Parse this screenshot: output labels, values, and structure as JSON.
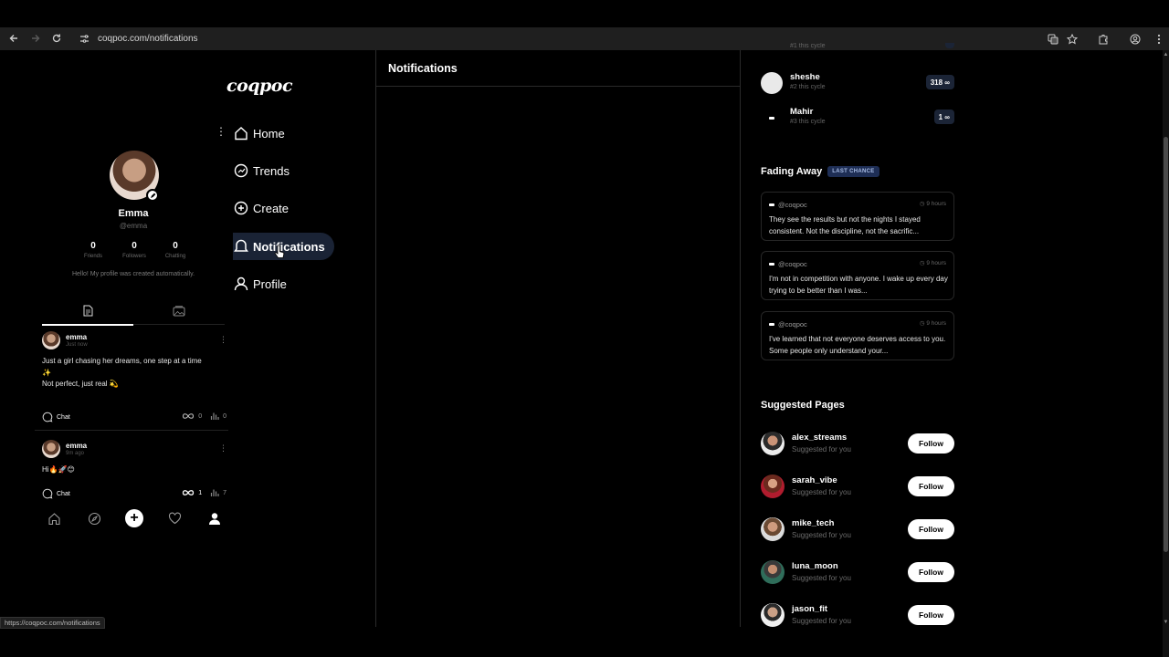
{
  "browser": {
    "url": "coqpoc.com/notifications",
    "status_url": "https://coqpoc.com/notifications"
  },
  "brand": "coqpoc",
  "profile": {
    "name": "Emma",
    "handle": "@emma",
    "stats": [
      {
        "value": "0",
        "label": "Friends"
      },
      {
        "value": "0",
        "label": "Followers"
      },
      {
        "value": "0",
        "label": "Chatting"
      }
    ],
    "bio": "Hello! My profile was created automatically."
  },
  "posts": [
    {
      "author": "emma",
      "time": "Just now",
      "lines": [
        "Just a girl chasing her dreams, one step at a time",
        "✨",
        "Not perfect, just real 💫"
      ],
      "chat_label": "Chat",
      "infinity_count": "0",
      "views_count": "0"
    },
    {
      "author": "emma",
      "time": "9m ago",
      "lines": [
        "Hi🔥🚀😊"
      ],
      "chat_label": "Chat",
      "infinity_count": "1",
      "views_count": "7"
    }
  ],
  "nav": {
    "items": [
      {
        "label": "Home",
        "icon": "home-icon"
      },
      {
        "label": "Trends",
        "icon": "trends-icon"
      },
      {
        "label": "Create",
        "icon": "create-icon"
      },
      {
        "label": "Notifications",
        "icon": "notifications-icon",
        "active": true
      },
      {
        "label": "Profile",
        "icon": "profile-icon"
      }
    ]
  },
  "main": {
    "title": "Notifications"
  },
  "leaderboard": [
    {
      "name": "",
      "rank": "#1 this cycle",
      "score": ""
    },
    {
      "name": "sheshe",
      "rank": "#2 this cycle",
      "score": "318 ∞"
    },
    {
      "name": "Mahir",
      "rank": "#3 this cycle",
      "score": "1 ∞"
    }
  ],
  "fading": {
    "title": "Fading Away",
    "badge": "LAST CHANCE",
    "cards": [
      {
        "user": "@coqpoc",
        "time": "9 hours",
        "text": "They see the results but not the nights I stayed consistent. Not the discipline, not the sacrific..."
      },
      {
        "user": "@coqpoc",
        "time": "9 hours",
        "text": "I'm not in competition with anyone. I wake up every day trying to be better than I was..."
      },
      {
        "user": "@coqpoc",
        "time": "9 hours",
        "text": "I've learned that not everyone deserves access to you. Some people only understand your..."
      }
    ]
  },
  "suggested": {
    "title": "Suggested Pages",
    "follow_label": "Follow",
    "items": [
      {
        "name": "alex_streams",
        "subtitle": "Suggested for you"
      },
      {
        "name": "sarah_vibe",
        "subtitle": "Suggested for you"
      },
      {
        "name": "mike_tech",
        "subtitle": "Suggested for you"
      },
      {
        "name": "luna_moon",
        "subtitle": "Suggested for you"
      },
      {
        "name": "jason_fit",
        "subtitle": "Suggested for you"
      }
    ]
  },
  "colors": {
    "background": "#000000",
    "active_nav": "#1a2335",
    "badge": "#1e2e55"
  }
}
